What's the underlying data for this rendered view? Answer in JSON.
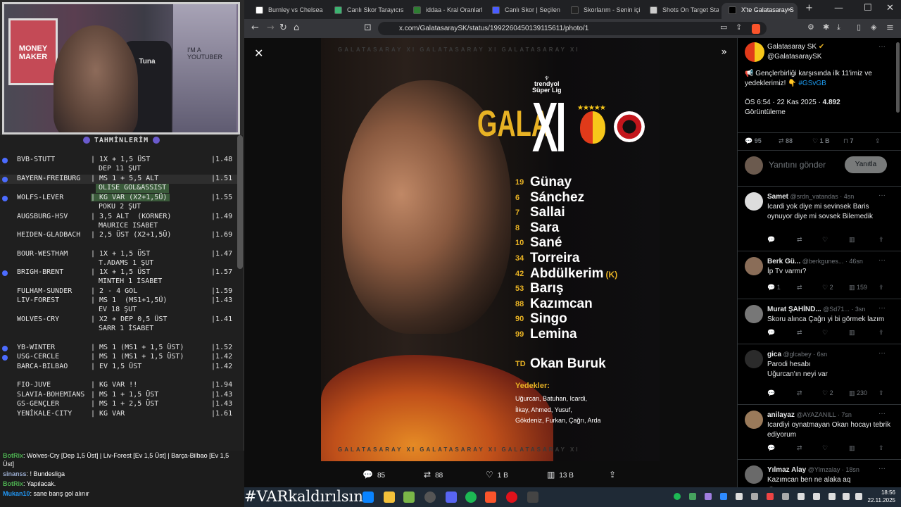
{
  "stream": {
    "cam": {
      "poster_text": "MONEY MAKER",
      "chair_text": "Tuna",
      "shelf_text": "I'M A YOUTUBER"
    },
    "predictions_title": "TAHMİNLERİM",
    "rows": [
      {
        "match": "BVB-STUTT",
        "pick": "1X + 1,5 ÜST",
        "odd": "|1.48",
        "dot": true,
        "sub": "DEP 11 ŞUT"
      },
      {
        "match": "BAYERN-FREIBURG",
        "pick": "MS 1 + 5,5 ALT",
        "odd": "|1.51",
        "dot": true,
        "hl": true,
        "sub": "OLISE GOL&ASSIST",
        "subgreen": true
      },
      {
        "match": "WOLFS-LEVER",
        "pick": "KG VAR (X2+1,5Ü)",
        "odd": "|1.55",
        "dot": true,
        "green": true,
        "sub": "POKU 2 ŞUT"
      },
      {
        "match": "AUGSBURG-HSV",
        "pick": "3,5 ALT  (KORNER)",
        "odd": "|1.49",
        "sub": "MAURICE ISABET"
      },
      {
        "match": "HEIDEN-GLADBACH",
        "pick": "2,5 ÜST (X2+1,5Ü)",
        "odd": "|1.69"
      },
      {
        "match": "BOUR-WESTHAM",
        "pick": "1X + 1,5 ÜST",
        "odd": "|1.47",
        "sub": "T.ADAMS 1 ŞUT"
      },
      {
        "match": "BRIGH-BRENT",
        "pick": "1X + 1,5 ÜST",
        "odd": "|1.57",
        "dot": true,
        "sub": "MINTEH 1 İSABET"
      },
      {
        "match": "FULHAM-SUNDER",
        "pick": "2 - 4 GOL",
        "odd": "|1.59"
      },
      {
        "match": "LIV-FOREST",
        "pick": "MS 1  (MS1+1,5Ü)",
        "odd": "|1.43",
        "sub": "EV 18 ŞUT"
      },
      {
        "match": "WOLVES-CRY",
        "pick": "X2 + DEP 0,5 ÜST",
        "odd": "|1.41",
        "sub": "SARR 1 İSABET"
      },
      {
        "match": "YB-WINTER",
        "pick": "MS 1 (MS1 + 1,5 ÜST)",
        "odd": "|1.52",
        "dot": true
      },
      {
        "match": "USG-CERCLE",
        "pick": "MS 1 (MS1 + 1,5 ÜST)",
        "odd": "|1.42",
        "dot": true
      },
      {
        "match": "BARCA-BILBAO",
        "pick": "EV 1,5 ÜST",
        "odd": "|1.42"
      },
      {
        "match": "FIO-JUVE",
        "pick": "KG VAR !!",
        "odd": "|1.94"
      },
      {
        "match": "SLAVIA-BOHEMIANS",
        "pick": "MS 1 + 1,5 ÜST",
        "odd": "|1.43"
      },
      {
        "match": "GS-GENÇLER",
        "pick": "MS 1 + 2,5 ÜST",
        "odd": "|1.43"
      },
      {
        "match": "YENİKALE-CITY",
        "pick": "KG VAR",
        "odd": "|1.61"
      }
    ],
    "chat": [
      {
        "user": "BotRix",
        "text": ": Wolves-Cry [Dep 1,5 Üst] | Liv-Forest [Ev 1,5 Üst] | Barça-Bilbao [Ev 1,5 Üst]",
        "type": "bot"
      },
      {
        "user": "sinanss",
        "text": ": ! Bundesliga",
        "type": "u3"
      },
      {
        "user": "BotRix",
        "text": ": Yapılacak.",
        "type": "bot"
      },
      {
        "user": "Mukan10",
        "text": ": sane barış gol alınır",
        "type": "u2"
      }
    ]
  },
  "browser": {
    "tabs": [
      {
        "label": "Burnley vs Chelsea Stat",
        "color": "#fff"
      },
      {
        "label": "Canlı Skor Tarayıcısı ve",
        "color": "#3cb371"
      },
      {
        "label": "iddaa - Kral Oranlarla",
        "color": "#2e7d32"
      },
      {
        "label": "Canlı Skor | Seçilen ma",
        "color": "#4a5cff"
      },
      {
        "label": "Skorlarım - Senin için",
        "color": "#222"
      },
      {
        "label": "Shots On Target Statis",
        "color": "#ccc"
      },
      {
        "label": "X'te Galatasaray S",
        "color": "#000",
        "active": true
      }
    ],
    "new_tab": "+",
    "win_min": "—",
    "win_max": "☐",
    "win_close": "✕",
    "url": "x.com/GalatasaraySK/status/1992260450139115611/photo/1"
  },
  "photo": {
    "watermark": "GALATASARAY XI      GALATASARAY XI      GALATASARAY XI",
    "brand_top": "trendyol",
    "brand_bottom": "Süper Lig",
    "gala": "GALA",
    "xi": "XI",
    "stars": "★★★★★",
    "players": [
      {
        "no": "19",
        "name": "Günay"
      },
      {
        "no": "6",
        "name": "Sánchez"
      },
      {
        "no": "7",
        "name": "Sallai"
      },
      {
        "no": "8",
        "name": "Sara"
      },
      {
        "no": "10",
        "name": "Sané"
      },
      {
        "no": "34",
        "name": "Torreira"
      },
      {
        "no": "42",
        "name": "Abdülkerim",
        "captain": "(K)"
      },
      {
        "no": "53",
        "name": "Barış"
      },
      {
        "no": "88",
        "name": "Kazımcan"
      },
      {
        "no": "90",
        "name": "Singo"
      },
      {
        "no": "99",
        "name": "Lemina"
      }
    ],
    "coach": {
      "no": "TD",
      "name": "Okan Buruk"
    },
    "subs_title": "Yedekler:",
    "subs": [
      "Uğurcan, Batuhan, Icardi,",
      "İlkay, Ahmed, Yusuf,",
      "Gökdeniz, Furkan, Çağrı, Arda"
    ],
    "stats": {
      "replies": "85",
      "reposts": "88",
      "likes": "1 B",
      "views": "13 B"
    }
  },
  "tweet": {
    "name": "Galatasaray SK",
    "handle": "@GalatasaraySK",
    "text": "📢 Gençlerbirliği karşısında ilk 11'imiz ve yedeklerimiz! 👇",
    "hashtag": "#GSvGB",
    "time": "ÖS 6:54 · 22 Kas 2025 · ",
    "views_n": "4.892",
    "views_l": "Görüntüleme",
    "replies": "95",
    "reposts": "88",
    "likes": "1 B",
    "bookmarks": "7",
    "reply_placeholder": "Yanıtını gönder",
    "reply_button": "Yanıtla"
  },
  "replies": [
    {
      "name": "Samet",
      "handle": "@srdn_vatandas · 4sn",
      "text": "Icardi yok diye mi sevinsek Baris oynuyor diye mi sovsek Bilemedik",
      "likes": "",
      "views": ""
    },
    {
      "name": "Berk Gü...",
      "handle": "@berkgunes... · 46sn",
      "text": "İp Tv varmı?",
      "replies": "1",
      "likes": "2",
      "views": "159"
    },
    {
      "name": "Murat ŞAHİND...",
      "handle": "@Sd71... · 3sn",
      "text": "Skoru alınca Çağrı yi bi görmek lazım"
    },
    {
      "name": "gica",
      "handle": "@glcabey · 6sn",
      "note": "Parodi hesabı",
      "text": "Uğurcan'ın neyi var",
      "likes": "2",
      "views": "230"
    },
    {
      "name": "anilayaz",
      "handle": "@AYAZANILL · 7sn",
      "text": "Icardiyi oynatmayan Okan hocayı tebrik ediyorum"
    },
    {
      "name": "Yılmaz Alay",
      "handle": "@Ylmzalay · 18sn",
      "text": "Kazımcan ben ne alaka aq"
    }
  ],
  "taskbar": {
    "hashtag": "#VARkaldırılsın",
    "time": "18:56",
    "date": "22.11.2025"
  }
}
